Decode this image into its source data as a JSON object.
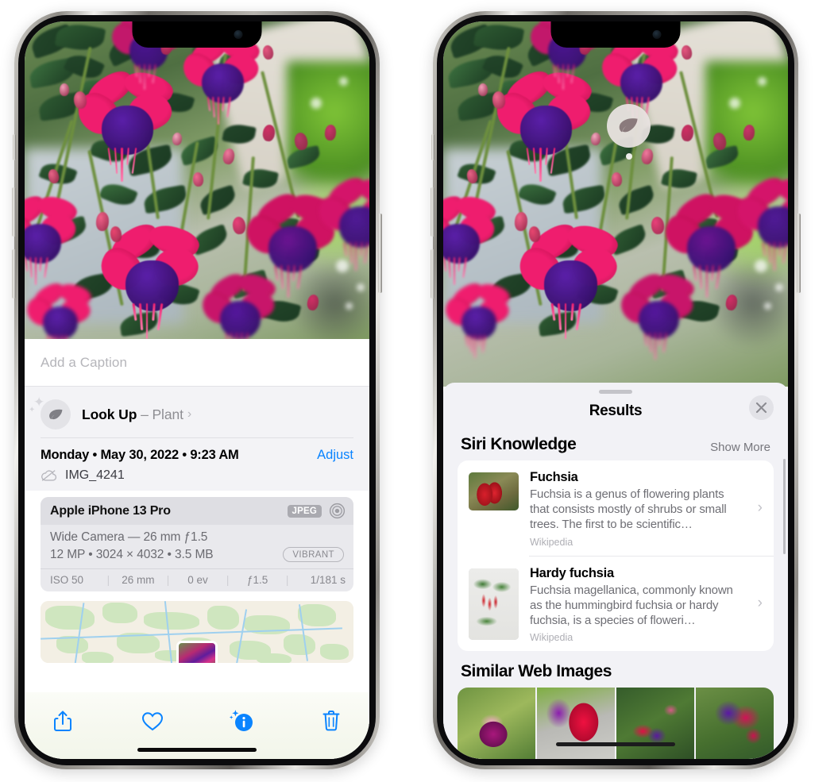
{
  "left_phone": {
    "name": "iphone-photos-info-view",
    "caption": {
      "placeholder": "Add a Caption",
      "value": ""
    },
    "lookup": {
      "icon": "leaf-icon",
      "sparkle_icon": "sparkle-icon",
      "label": "Look Up",
      "dash": "–",
      "subject": "Plant",
      "chevron": "›"
    },
    "metadata": {
      "date_line": "Monday • May 30, 2022 • 9:23 AM",
      "adjust_label": "Adjust",
      "cloud_icon": "cloud-slash-icon",
      "filename": "IMG_4241"
    },
    "camera_card": {
      "device": "Apple iPhone 13 Pro",
      "format_badge": "JPEG",
      "aperture_icon": "aperture-icon",
      "lens_line": "Wide Camera — 26 mm ƒ1.5",
      "specs_line": "12 MP • 3024 × 4032 • 3.5 MB",
      "style_badge": "VIBRANT",
      "exif": [
        "ISO 50",
        "26 mm",
        "0 ev",
        "ƒ1.5",
        "1/181 s"
      ]
    },
    "map": {
      "name": "location-map-thumbnail"
    },
    "toolbar": [
      {
        "name": "share-button",
        "icon": "share-icon"
      },
      {
        "name": "favorite-button",
        "icon": "heart-icon"
      },
      {
        "name": "info-button",
        "icon": "info-sparkle-icon"
      },
      {
        "name": "delete-button",
        "icon": "trash-icon"
      }
    ]
  },
  "right_phone": {
    "name": "visual-lookup-results-view",
    "photo_badge": {
      "icon": "leaf-icon",
      "name": "visual-lookup-leaf-badge"
    },
    "sheet": {
      "title": "Results",
      "close_icon": "close-icon",
      "sections": [
        {
          "title": "Siri Knowledge",
          "action_label": "Show More",
          "items": [
            {
              "title": "Fuchsia",
              "description": "Fuchsia is a genus of flowering plants that consists mostly of shrubs or small trees. The first to be scientific…",
              "source": "Wikipedia",
              "chevron": "›"
            },
            {
              "title": "Hardy fuchsia",
              "description": "Fuchsia magellanica, commonly known as the hummingbird fuchsia or hardy fuchsia, is a species of floweri…",
              "source": "Wikipedia",
              "chevron": "›"
            }
          ]
        },
        {
          "title": "Similar Web Images",
          "images": [
            {
              "name": "similar-image-1"
            },
            {
              "name": "similar-image-2"
            },
            {
              "name": "similar-image-3"
            },
            {
              "name": "similar-image-4"
            }
          ]
        }
      ]
    }
  },
  "colors": {
    "accent_blue": "#0a84ff",
    "sheet_bg": "#f2f2f6",
    "card_bg": "#ffffff",
    "secondary_text": "#6e6e74",
    "tertiary_text": "#aeaeb4"
  }
}
